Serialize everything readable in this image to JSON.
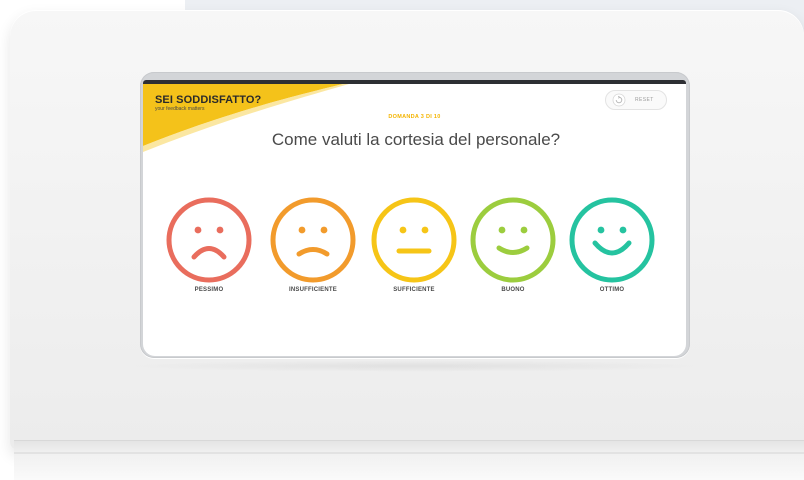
{
  "banner": {
    "title": "SEI SODDISFATTO?",
    "subtitle": "your feedback matters",
    "color": "#f4c21a"
  },
  "reset": {
    "label": "RESET",
    "icon": "refresh-icon"
  },
  "survey": {
    "counter": "DOMANDA 3 DI 10",
    "question": "Come valuti la cortesia del personale?",
    "options": [
      {
        "label": "PESSIMO",
        "icon": "very-sad-face-icon",
        "color": "#e96d5d"
      },
      {
        "label": "INSUFFICIENTE",
        "icon": "sad-face-icon",
        "color": "#f29b2c"
      },
      {
        "label": "SUFFICIENTE",
        "icon": "neutral-face-icon",
        "color": "#f6c517"
      },
      {
        "label": "BUONO",
        "icon": "happy-face-icon",
        "color": "#9ccd3e"
      },
      {
        "label": "OTTIMO",
        "icon": "very-happy-face-icon",
        "color": "#25c3a0"
      }
    ]
  }
}
